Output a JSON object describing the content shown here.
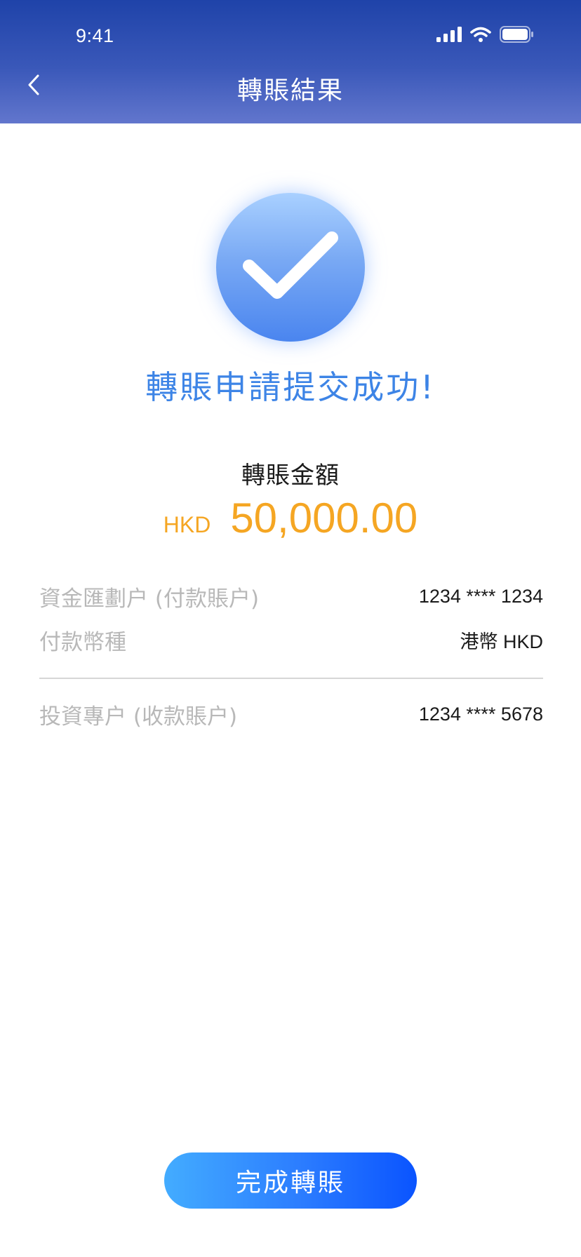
{
  "status_bar": {
    "time": "9:41",
    "icons": [
      "signal-icon",
      "wifi-icon",
      "battery-icon"
    ]
  },
  "header": {
    "back_icon": "chevron-left-icon",
    "title": "轉賬結果"
  },
  "result": {
    "icon": "check-circle-icon",
    "message": "轉賬申請提交成功!"
  },
  "amount": {
    "label": "轉賬金額",
    "currency": "HKD",
    "value": "50,000.00"
  },
  "details": [
    {
      "label": "資金匯劃户 (付款賬户)",
      "value": "1234 **** 1234"
    },
    {
      "label": "付款幣種",
      "value": "港幣 HKD"
    },
    {
      "label": "投資專户 (收款賬户)",
      "value": "1234 **** 5678"
    }
  ],
  "button": {
    "label": "完成轉賬"
  },
  "colors": {
    "header_top": "#1f43a9",
    "header_bottom": "#6276cd",
    "success_text": "#3d84e6",
    "amount": "#f5a623",
    "label_gray": "#b8b8b8",
    "button_start": "#43acff",
    "button_end": "#0a54ff"
  }
}
